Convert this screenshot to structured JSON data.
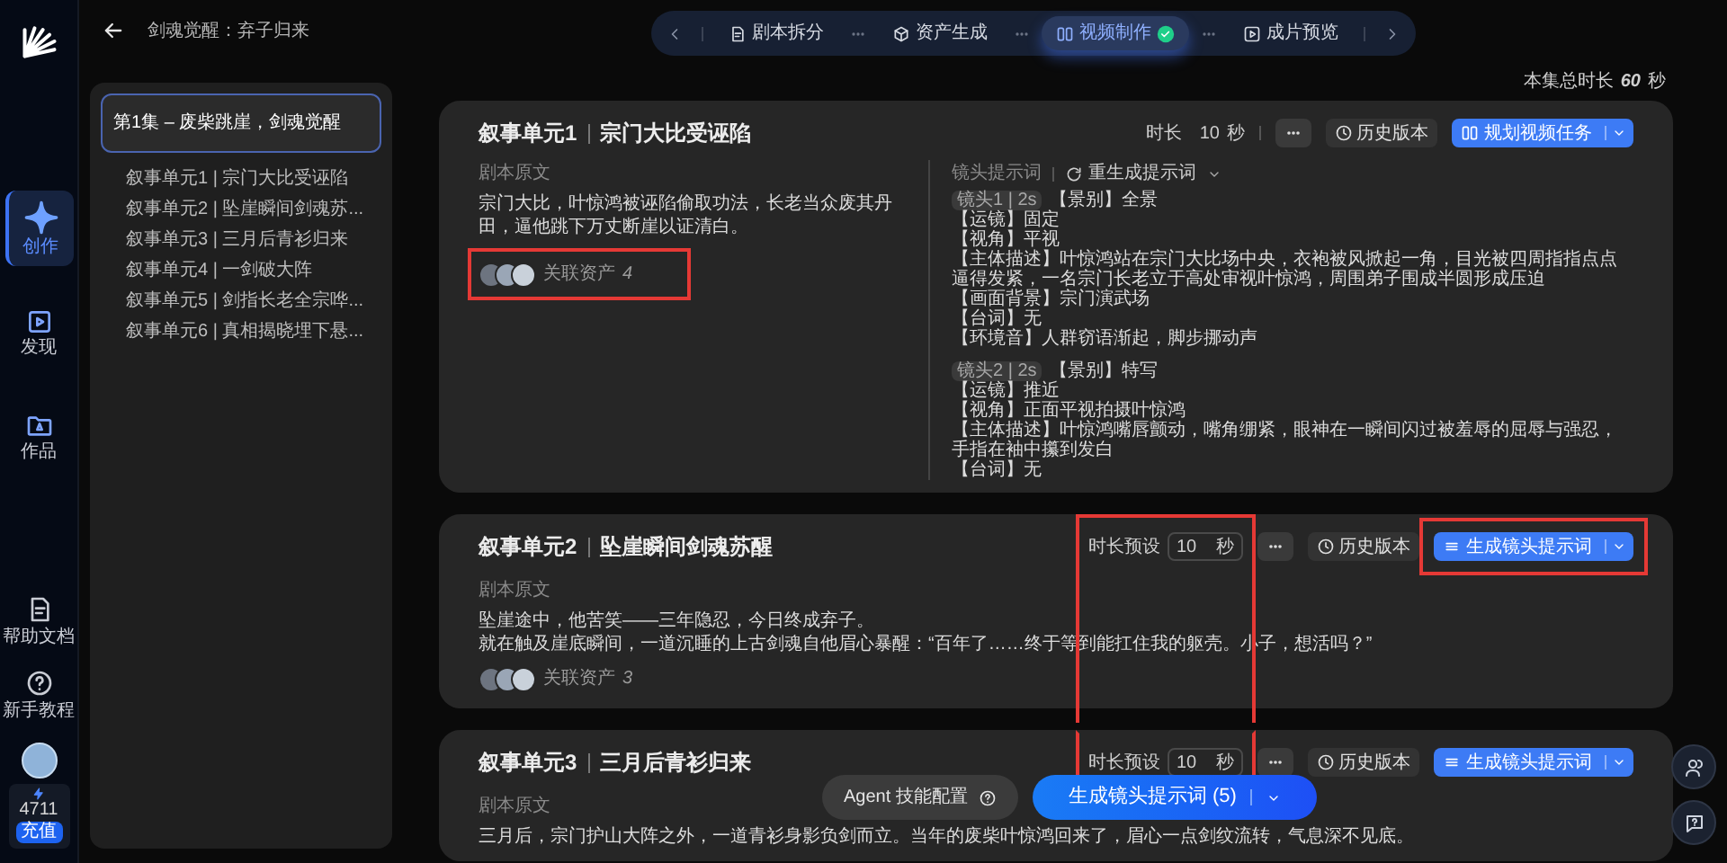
{
  "rail": {
    "nav": [
      {
        "label": "创作",
        "selected": true
      },
      {
        "label": "发现",
        "selected": false
      },
      {
        "label": "作品",
        "selected": false
      }
    ],
    "links": [
      {
        "label": "帮助文档"
      },
      {
        "label": "新手教程"
      }
    ],
    "credits": {
      "amount": "4711",
      "button": "充值"
    }
  },
  "header": {
    "title": "剑魂觉醒：弃子归来"
  },
  "steps": [
    {
      "label": "剧本拆分",
      "selected": false,
      "done": false
    },
    {
      "label": "资产生成",
      "selected": false,
      "done": false
    },
    {
      "label": "视频制作",
      "selected": true,
      "done": true
    },
    {
      "label": "成片预览",
      "selected": false,
      "done": false
    }
  ],
  "total_duration": {
    "label": "本集总时长",
    "value": "60",
    "unit": "秒"
  },
  "sidebar": {
    "episode": {
      "label": "第1集 – 废柴跳崖，剑魂觉醒",
      "selected": true
    },
    "units": [
      {
        "label": "叙事单元1 | 宗门大比受诬陷",
        "selected": false
      },
      {
        "label": "叙事单元2 | 坠崖瞬间剑魂苏...",
        "selected": false
      },
      {
        "label": "叙事单元3 | 三月后青衫归来",
        "selected": false
      },
      {
        "label": "叙事单元4 | 一剑破大阵",
        "selected": false
      },
      {
        "label": "叙事单元5 | 剑指长老全宗哗...",
        "selected": false
      },
      {
        "label": "叙事单元6 | 真相揭晓埋下悬...",
        "selected": false
      }
    ]
  },
  "units": [
    {
      "title": "叙事单元1",
      "subtitle": "宗门大比受诬陷",
      "duration": {
        "kind": "fixed",
        "label": "时长",
        "value": "10",
        "unit": "秒",
        "highlighted": false
      },
      "history": "历史版本",
      "action": {
        "kind": "plan",
        "label": "规划视频任务",
        "highlighted": false
      },
      "source_label": "剧本原文",
      "source_text": [
        "宗门大比，叶惊鸿被诬陷偷取功法，长老当众废其丹田，逼他跳下万丈断崖以证清白。"
      ],
      "assets": {
        "label": "关联资产",
        "count": "4",
        "highlighted": true
      },
      "prompt": {
        "label": "镜头提示词",
        "regenerate": "重生成提示词",
        "shots": [
          {
            "tag": "镜头1 | 2s",
            "lines": [
              "【景别】全景",
              "【运镜】固定",
              "【视角】平视",
              "【主体描述】叶惊鸿站在宗门大比场中央，衣袍被风掀起一角，目光被四周指指点点逼得发紧，一名宗门长老立于高处审视叶惊鸿，周围弟子围成半圆形成压迫",
              "【画面背景】宗门演武场",
              "【台词】无",
              "【环境音】人群窃语渐起，脚步挪动声"
            ]
          },
          {
            "tag": "镜头2 | 2s",
            "lines": [
              "【景别】特写",
              "【运镜】推近",
              "【视角】正面平视拍摄叶惊鸿",
              "【主体描述】叶惊鸿嘴唇颤动，嘴角绷紧，眼神在一瞬间闪过被羞辱的屈辱与强忍，手指在袖中攥到发白",
              "【台词】无"
            ]
          }
        ]
      }
    },
    {
      "title": "叙事单元2",
      "subtitle": "坠崖瞬间剑魂苏醒",
      "duration": {
        "kind": "preset",
        "label": "时长预设",
        "value": "10",
        "unit": "秒",
        "highlighted": true
      },
      "history": "历史版本",
      "action": {
        "kind": "generate",
        "label": "生成镜头提示词",
        "highlighted": true
      },
      "source_label": "剧本原文",
      "source_text": [
        "坠崖途中，他苦笑——三年隐忍，今日终成弃子。",
        "就在触及崖底瞬间，一道沉睡的上古剑魂自他眉心暴醒：“百年了……终于等到能扛住我的躯壳。小子，想活吗？”"
      ],
      "assets": {
        "label": "关联资产",
        "count": "3",
        "highlighted": false
      }
    },
    {
      "title": "叙事单元3",
      "subtitle": "三月后青衫归来",
      "duration": {
        "kind": "preset",
        "label": "时长预设",
        "value": "10",
        "unit": "秒",
        "highlighted": true
      },
      "history": "历史版本",
      "action": {
        "kind": "generate",
        "label": "生成镜头提示词",
        "highlighted": false
      },
      "source_label": "剧本原文",
      "source_text": [
        "三月后，宗门护山大阵之外，一道青衫身影负剑而立。当年的废柴叶惊鸿回来了，眉心一点剑纹流转，气息深不见底。"
      ]
    }
  ],
  "agent_bar": {
    "config_button": "Agent 技能配置",
    "generate_button": "生成镜头提示词 (5)"
  }
}
